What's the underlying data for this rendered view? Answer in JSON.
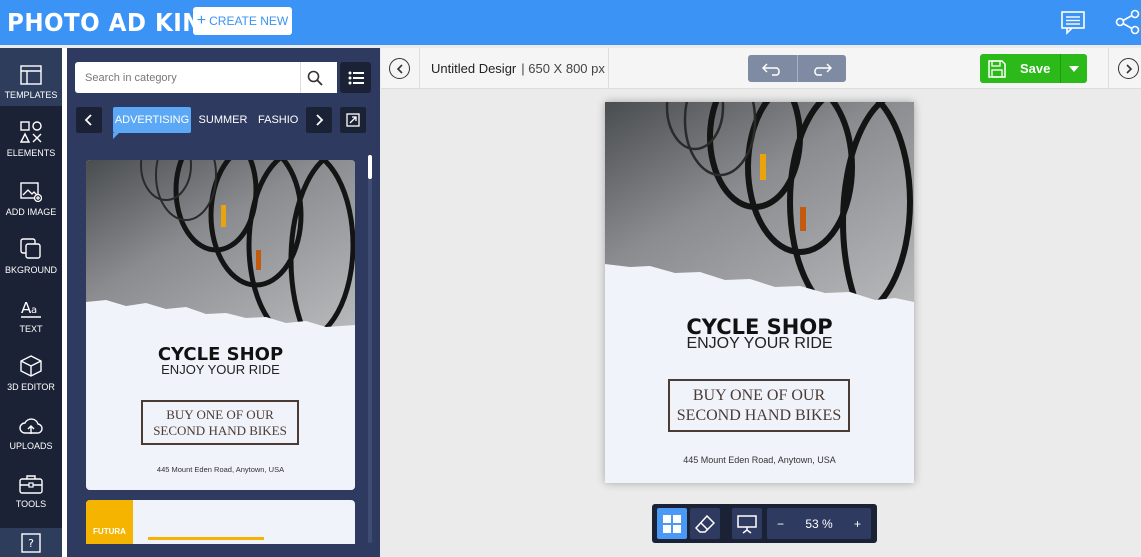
{
  "app": {
    "logo": "PHOTO AD KING"
  },
  "topbar": {
    "create_label": "CREATE NEW",
    "create_icon": "plus-icon",
    "icons": [
      "comment-icon",
      "share-icon"
    ]
  },
  "rail": {
    "items": [
      {
        "label": "TEMPLATES",
        "icon": "templates-icon"
      },
      {
        "label": "ELEMENTS",
        "icon": "shapes-icon"
      },
      {
        "label": "ADD IMAGE",
        "icon": "add-image-icon"
      },
      {
        "label": "BKGROUND",
        "icon": "background-icon"
      },
      {
        "label": "TEXT",
        "icon": "text-icon"
      },
      {
        "label": "3D EDITOR",
        "icon": "cube-icon"
      },
      {
        "label": "UPLOADS",
        "icon": "cloud-upload-icon"
      },
      {
        "label": "TOOLS",
        "icon": "toolbox-icon"
      }
    ]
  },
  "panel": {
    "search_placeholder": "Search in category",
    "categories": [
      "ADVERTISING",
      "SUMMER",
      "FASHIO"
    ],
    "template1": {
      "headline": "CYCLE SHOP",
      "tagline": "ENJOY YOUR RIDE",
      "offer_line1": "BUY ONE OF OUR",
      "offer_line2": "SECOND HAND BIKES",
      "address": "445 Mount Eden Road, Anytown, USA"
    },
    "template2": {
      "tag": "FUTURA"
    }
  },
  "editor": {
    "doc_name": "Untitled Desigr",
    "doc_size": "| 650 X 800 px",
    "save_label": "Save",
    "canvas": {
      "headline": "CYCLE SHOP",
      "tagline": "ENJOY YOUR RIDE",
      "offer_line1": "BUY ONE OF OUR",
      "offer_line2": "SECOND HAND BIKES",
      "address": "445 Mount Eden Road, Anytown, USA"
    },
    "zoom": {
      "value": "53 %",
      "minus": "−",
      "plus": "+"
    }
  },
  "colors": {
    "topbar": "#3a93f5",
    "rail": "#1c2236",
    "panel": "#2e3a5f",
    "accent": "#5aa8f6",
    "save": "#2bba19"
  }
}
